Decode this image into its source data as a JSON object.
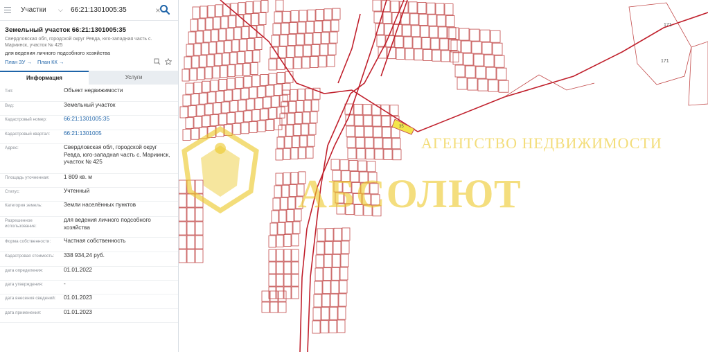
{
  "search": {
    "layer": "Участки",
    "query": "66:21:1301005:35"
  },
  "object": {
    "title": "Земельный участок 66:21:1301005:35",
    "address_short": "Свердловская обл, городской округ Ревда, юго-западная часть с. Мариинск, участок № 425",
    "use": "для ведения личного подсобного хозяйства",
    "plan_zu": "План ЗУ →",
    "plan_kk": "План КК →"
  },
  "tabs": {
    "info": "Информация",
    "services": "Услуги"
  },
  "details": [
    {
      "label": "Тип:",
      "value": "Объект недвижимости"
    },
    {
      "label": "Вид:",
      "value": "Земельный участок"
    },
    {
      "label": "Кадастровый номер:",
      "value": "66:21:1301005:35"
    },
    {
      "label": "Кадастровый квартал:",
      "value": "66:21:1301005"
    },
    {
      "label": "Адрес:",
      "value": "Свердловская обл, городской округ Ревда, юго-западная часть с. Мариинск, участок № 425"
    },
    {
      "label": "Площадь уточненная:",
      "value": "1 809 кв. м"
    },
    {
      "label": "Статус:",
      "value": "Учтенный"
    },
    {
      "label": "Категория земель:",
      "value": "Земли населённых пунктов"
    },
    {
      "label": "Разрешенное использование:",
      "value": "для ведения личного подсобного хозяйства"
    },
    {
      "label": "Форма собственности:",
      "value": "Частная собственность"
    },
    {
      "label": "Кадастровая стоимость:",
      "value": "338 934,24 руб."
    },
    {
      "label": "дата определения:",
      "value": "01.01.2022"
    },
    {
      "label": "дата утверждения:",
      "value": "-"
    },
    {
      "label": "дата внесения сведений:",
      "value": "01.01.2023"
    },
    {
      "label": "дата применения:",
      "value": "01.01.2023"
    }
  ],
  "map": {
    "labels": [
      "171",
      "171",
      "35"
    ],
    "watermark": {
      "line1": "АГЕНТСТВО НЕДВИЖИМОСТИ",
      "line2": "АБСОЛЮТ"
    }
  },
  "colors": {
    "accent": "#1f64a8",
    "plot_border": "#c24a4a",
    "selected_plot": "#f3e64a"
  }
}
